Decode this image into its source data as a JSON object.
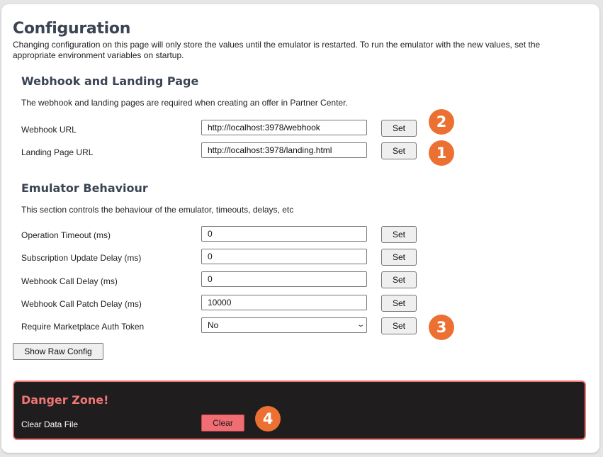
{
  "header": {
    "title": "Configuration",
    "intro": "Changing configuration on this page will only store the values until the emulator is restarted. To run the emulator with the new values, set the appropriate environment variables on startup."
  },
  "webhook_section": {
    "title": "Webhook and Landing Page",
    "description": "The webhook and landing pages are required when creating an offer in Partner Center.",
    "rows": [
      {
        "label": "Webhook URL",
        "value": "http://localhost:3978/webhook",
        "button": "Set"
      },
      {
        "label": "Landing Page URL",
        "value": "http://localhost:3978/landing.html",
        "button": "Set"
      }
    ]
  },
  "emulator_section": {
    "title": "Emulator Behaviour",
    "description": "This section controls the behaviour of the emulator, timeouts, delays, etc",
    "rows": [
      {
        "label": "Operation Timeout (ms)",
        "value": "0",
        "button": "Set"
      },
      {
        "label": "Subscription Update Delay (ms)",
        "value": "0",
        "button": "Set"
      },
      {
        "label": "Webhook Call Delay (ms)",
        "value": "0",
        "button": "Set"
      },
      {
        "label": "Webhook Call Patch Delay (ms)",
        "value": "10000",
        "button": "Set"
      },
      {
        "label": "Require Marketplace Auth Token",
        "value": "No",
        "button": "Set"
      }
    ]
  },
  "show_raw_config_label": "Show Raw Config",
  "danger_zone": {
    "title": "Danger Zone!",
    "label": "Clear Data File",
    "button": "Clear"
  },
  "badges": [
    "2",
    "1",
    "3",
    "4"
  ],
  "colors": {
    "badge": "#ec7032",
    "danger_accent": "#f07676",
    "danger_background": "#1f1d1e"
  }
}
